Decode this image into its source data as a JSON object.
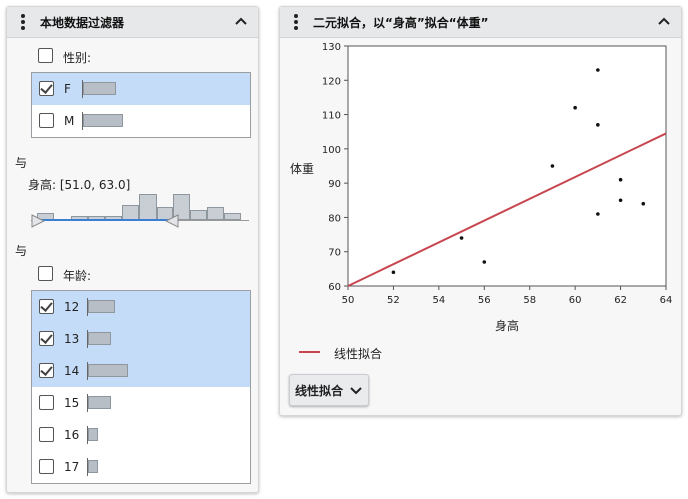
{
  "left_panel": {
    "title": "本地数据过滤器",
    "gender": {
      "label": "性别:",
      "items": [
        {
          "label": "F",
          "checked": true,
          "selected": true,
          "count_fraction": 0.45
        },
        {
          "label": "M",
          "checked": false,
          "selected": false,
          "count_fraction": 0.55
        }
      ]
    },
    "and_1": "与",
    "height_filter": {
      "label": "身高: [51.0, 63.0]",
      "histogram_fraction": [
        0.28,
        0.0,
        0.18,
        0.18,
        0.28,
        0.72,
        1.0,
        0.45,
        1.0,
        0.45,
        0.55,
        0.28
      ]
    },
    "and_2": "与",
    "age": {
      "label": "年龄:",
      "items": [
        {
          "label": "12",
          "checked": true,
          "selected": true,
          "count_fraction": 0.7
        },
        {
          "label": "13",
          "checked": true,
          "selected": true,
          "count_fraction": 0.6
        },
        {
          "label": "14",
          "checked": true,
          "selected": true,
          "count_fraction": 1.0
        },
        {
          "label": "15",
          "checked": false,
          "selected": false,
          "count_fraction": 0.6
        },
        {
          "label": "16",
          "checked": false,
          "selected": false,
          "count_fraction": 0.25
        },
        {
          "label": "17",
          "checked": false,
          "selected": false,
          "count_fraction": 0.25
        }
      ]
    }
  },
  "right_panel": {
    "title": "二元拟合，以“身高”拟合“体重”",
    "legend_label": "线性拟合",
    "fit_button_label": "线性拟合"
  },
  "chart_data": {
    "type": "scatter",
    "xlabel": "身高",
    "ylabel": "体重",
    "xlim": [
      50,
      64
    ],
    "ylim": [
      60,
      130
    ],
    "x_ticks": [
      "50",
      "52",
      "54",
      "56",
      "58",
      "60",
      "62",
      "64"
    ],
    "y_ticks": [
      "60",
      "70",
      "80",
      "90",
      "100",
      "110",
      "120",
      "130"
    ],
    "points": [
      {
        "x": 52,
        "y": 64
      },
      {
        "x": 55,
        "y": 74
      },
      {
        "x": 56,
        "y": 67
      },
      {
        "x": 59,
        "y": 95
      },
      {
        "x": 60,
        "y": 112
      },
      {
        "x": 61,
        "y": 123
      },
      {
        "x": 61,
        "y": 107
      },
      {
        "x": 61,
        "y": 81
      },
      {
        "x": 62,
        "y": 91
      },
      {
        "x": 62,
        "y": 85
      },
      {
        "x": 63,
        "y": 84
      }
    ],
    "fit_line": {
      "name": "线性拟合",
      "color": "#c8464f",
      "x": [
        50,
        64
      ],
      "y": [
        60,
        104.5
      ]
    },
    "grid": false
  }
}
